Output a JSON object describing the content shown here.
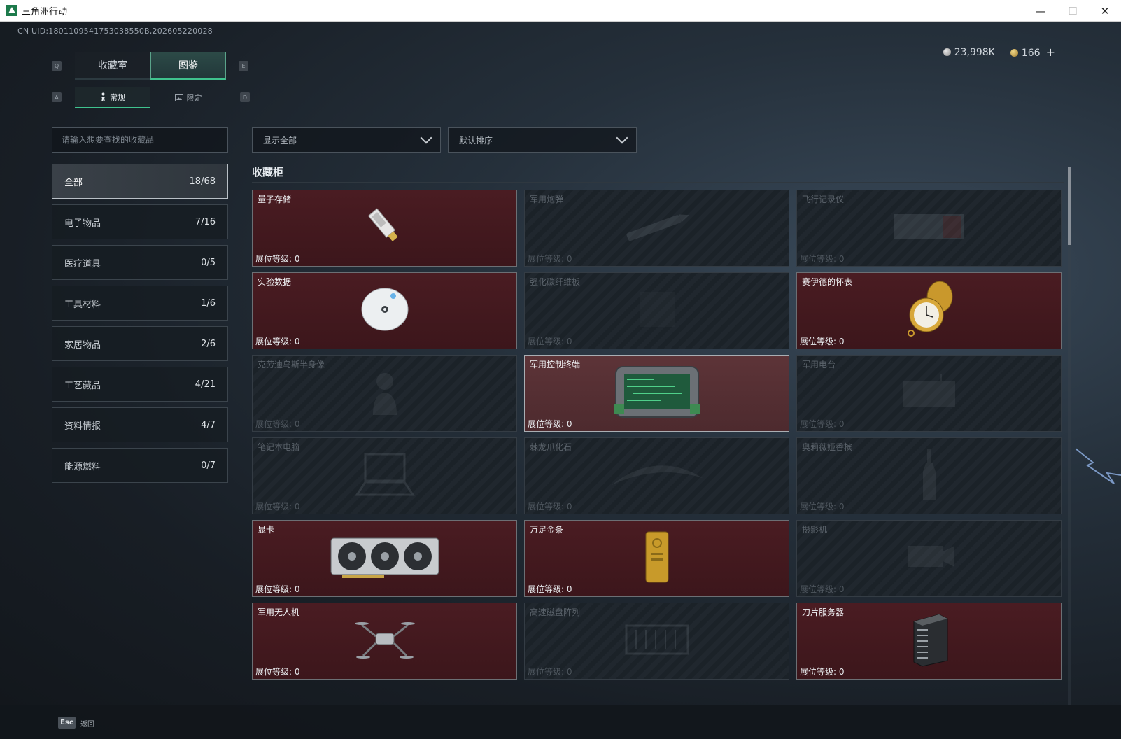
{
  "window": {
    "title": "三角洲行动",
    "minimize": "—",
    "maximize": "☐",
    "close": "✕"
  },
  "uid": "CN UID:1801109541753038550B,202605220028",
  "currency": {
    "silver": "23,998K",
    "gold": "166",
    "add": "+"
  },
  "keys": {
    "q": "Q",
    "e": "E",
    "a": "A",
    "d": "D"
  },
  "tabs": [
    {
      "label": "收藏室",
      "active": false
    },
    {
      "label": "图鉴",
      "active": true
    }
  ],
  "subtabs": [
    {
      "label": "常规",
      "icon": "figure-icon",
      "active": true
    },
    {
      "label": "限定",
      "icon": "picture-icon",
      "active": false
    }
  ],
  "search": {
    "placeholder": "请输入想要查找的收藏品"
  },
  "filters": {
    "display": "显示全部",
    "sort": "默认排序"
  },
  "categories": [
    {
      "label": "全部",
      "count": "18/68",
      "active": true
    },
    {
      "label": "电子物品",
      "count": "7/16"
    },
    {
      "label": "医疗道具",
      "count": "0/5"
    },
    {
      "label": "工具材料",
      "count": "1/6"
    },
    {
      "label": "家居物品",
      "count": "2/6"
    },
    {
      "label": "工艺藏品",
      "count": "4/21"
    },
    {
      "label": "资料情报",
      "count": "4/7"
    },
    {
      "label": "能源燃料",
      "count": "0/7"
    }
  ],
  "section": {
    "title": "收藏柜"
  },
  "level_label": "展位等级:",
  "items": [
    {
      "name": "量子存储",
      "level": "0",
      "state": "unlocked",
      "icon": "usb-drive-icon"
    },
    {
      "name": "军用炮弹",
      "level": "0",
      "state": "locked",
      "icon": "artillery-shell-icon"
    },
    {
      "name": "飞行记录仪",
      "level": "0",
      "state": "locked",
      "icon": "flight-recorder-icon"
    },
    {
      "name": "实验数据",
      "level": "0",
      "state": "unlocked",
      "icon": "disc-icon"
    },
    {
      "name": "强化碳纤维板",
      "level": "0",
      "state": "locked",
      "icon": "carbon-plate-icon"
    },
    {
      "name": "赛伊德的怀表",
      "level": "0",
      "state": "unlocked",
      "icon": "pocket-watch-icon"
    },
    {
      "name": "克劳迪乌斯半身像",
      "level": "0",
      "state": "locked",
      "icon": "bust-statue-icon"
    },
    {
      "name": "军用控制终端",
      "level": "0",
      "state": "highlight",
      "icon": "control-terminal-icon"
    },
    {
      "name": "军用电台",
      "level": "0",
      "state": "locked",
      "icon": "radio-icon"
    },
    {
      "name": "笔记本电脑",
      "level": "0",
      "state": "locked",
      "icon": "laptop-icon"
    },
    {
      "name": "棘龙爪化石",
      "level": "0",
      "state": "locked",
      "icon": "claw-fossil-icon"
    },
    {
      "name": "奥莉薇娅香槟",
      "level": "0",
      "state": "locked",
      "icon": "champagne-icon"
    },
    {
      "name": "显卡",
      "level": "0",
      "state": "unlocked",
      "icon": "graphics-card-icon"
    },
    {
      "name": "万足金条",
      "level": "0",
      "state": "unlocked",
      "icon": "gold-bar-icon"
    },
    {
      "name": "摄影机",
      "level": "0",
      "state": "locked",
      "icon": "camera-icon"
    },
    {
      "name": "军用无人机",
      "level": "0",
      "state": "unlocked",
      "icon": "drone-icon"
    },
    {
      "name": "高速磁盘阵列",
      "level": "0",
      "state": "locked",
      "icon": "disk-array-icon"
    },
    {
      "name": "刀片服务器",
      "level": "0",
      "state": "unlocked",
      "icon": "blade-server-icon"
    }
  ],
  "footer": {
    "key": "Esc",
    "label": "返回"
  }
}
